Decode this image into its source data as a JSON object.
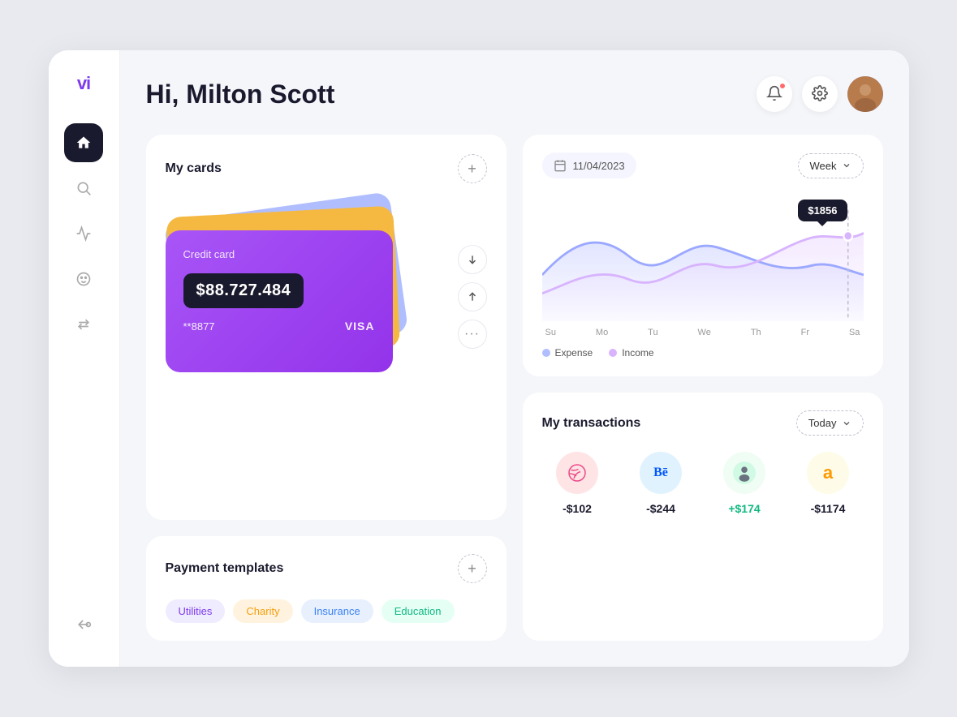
{
  "app": {
    "logo": "vi",
    "greeting": "Hi, Milton Scott"
  },
  "nav": {
    "items": [
      {
        "id": "home",
        "icon": "home",
        "active": true
      },
      {
        "id": "search",
        "icon": "search",
        "active": false
      },
      {
        "id": "activity",
        "icon": "activity",
        "active": false
      },
      {
        "id": "wallet",
        "icon": "wallet",
        "active": false
      },
      {
        "id": "transfer",
        "icon": "transfer",
        "active": false
      }
    ],
    "back_label": "←"
  },
  "header": {
    "title": "Hi, Milton Scott",
    "notifications_label": "notifications",
    "settings_label": "settings",
    "avatar_label": "user avatar"
  },
  "cards_section": {
    "title": "My cards",
    "add_label": "+",
    "card": {
      "label": "Credit card",
      "amount": "$88.727.484",
      "number": "**8877",
      "brand": "VISA"
    },
    "actions": {
      "down_label": "↓",
      "up_label": "↑",
      "more_label": "•••"
    }
  },
  "payment_section": {
    "title": "Payment templates",
    "add_label": "+",
    "tags": [
      {
        "id": "utilities",
        "label": "Utilities",
        "class": "tag-utilities"
      },
      {
        "id": "charity",
        "label": "Charity",
        "class": "tag-charity"
      },
      {
        "id": "insurance",
        "label": "Insurance",
        "class": "tag-insurance"
      },
      {
        "id": "education",
        "label": "Education",
        "class": "tag-education"
      }
    ]
  },
  "chart_section": {
    "date": "11/04/2023",
    "week_label": "Week",
    "tooltip_value": "$1856",
    "days": [
      "Su",
      "Mo",
      "Tu",
      "We",
      "Th",
      "Fr",
      "Sa"
    ],
    "legend": {
      "expense_label": "Expense",
      "income_label": "Income"
    }
  },
  "transactions_section": {
    "title": "My transactions",
    "period_label": "Today",
    "items": [
      {
        "id": "dribbble",
        "icon": "🏀",
        "icon_class": "icon-dribbble",
        "amount": "-$102",
        "type": "negative"
      },
      {
        "id": "behance",
        "icon": "Bē",
        "icon_class": "icon-behance",
        "amount": "-$244",
        "type": "negative"
      },
      {
        "id": "user",
        "icon": "👤",
        "icon_class": "icon-user",
        "amount": "+$174",
        "type": "positive"
      },
      {
        "id": "amazon",
        "icon": "a",
        "icon_class": "icon-amazon",
        "amount": "-$1174",
        "type": "negative"
      }
    ]
  }
}
